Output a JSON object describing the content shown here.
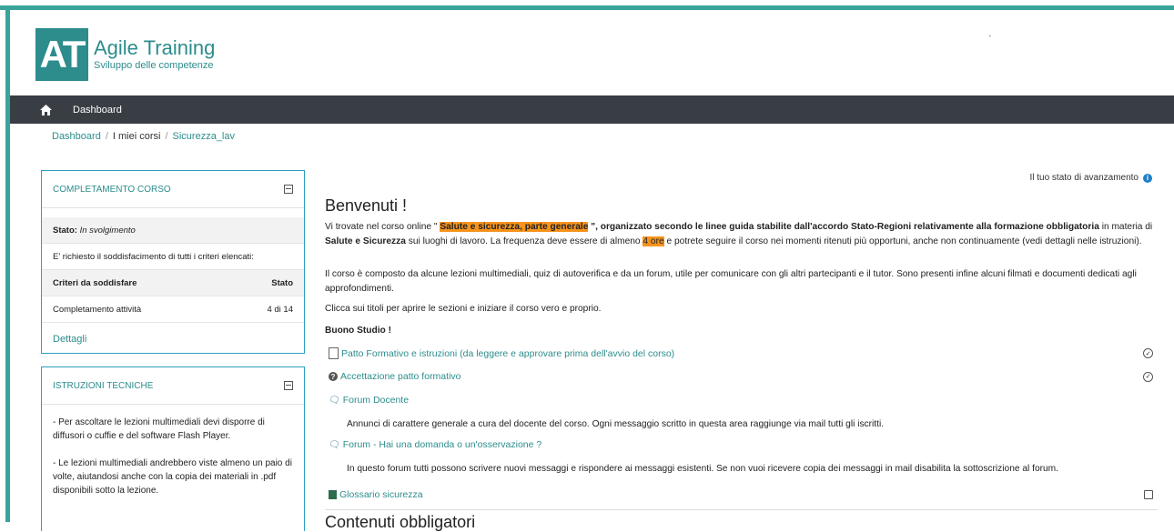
{
  "header": {
    "logo_mark": "AT",
    "logo_title": "Agile Training",
    "logo_subtitle": "Sviluppo delle competenze",
    "top_right_mark": "'"
  },
  "navbar": {
    "home_icon": "home-icon",
    "dashboard": "Dashboard"
  },
  "breadcrumb": {
    "items": [
      "Dashboard",
      "I miei corsi",
      "Sicurezza_lav"
    ],
    "separator": "/"
  },
  "completion_block": {
    "title": "COMPLETAMENTO CORSO",
    "status_label": "Stato:",
    "status_value": "In svolgimento",
    "requirement": "E' richiesto il soddisfacimento di tutti i criteri elencati:",
    "criteria_header": "Criteri da soddisfare",
    "status_header": "Stato",
    "criteria": [
      {
        "name": "Completamento attività",
        "status": "4 di 14"
      }
    ],
    "details_link": "Dettagli"
  },
  "instructions_block": {
    "title": "ISTRUZIONI TECNICHE",
    "paragraphs": [
      "- Per ascoltare le lezioni multimediali devi disporre di diffusori o cuffie e del software Flash Player.",
      "- Le lezioni multimediali andrebbero viste almeno un paio di volte, aiutandosi anche con la copia dei materiali in .pdf disponibili sotto la lezione."
    ]
  },
  "main": {
    "progress_label": "Il tuo stato di avanzamento",
    "welcome": "Benvenuti !",
    "intro": {
      "p1a": "Vi trovate nel corso online \" ",
      "p1_course": "Salute e sicurezza, parte generale",
      "p1b": " \", organizzato secondo le linee guida stabilite dall'accordo Stato-Regioni relativamente alla ",
      "p1_bold": "formazione obbligatoria",
      "p1c": " in materia di ",
      "p1_bold2": "Salute e Sicurezza",
      "p1d": " sui luoghi di lavoro. La frequenza deve essere di almeno ",
      "p1_hours": "4 ore",
      "p1e": "  e potrete seguire il corso  nei momenti ritenuti più opportuni, anche non continuamente (vedi dettagli nelle istruzioni).",
      "p2": "Il corso è composto da alcune lezioni multimediali, quiz di autoverifica e da un forum, utile per comunicare con gli altri partecipanti e il tutor. Sono presenti infine  alcuni filmati e documenti dedicati agli approfondimenti.",
      "p3": "Clicca sui titoli per aprire le sezioni e iniziare il corso vero e proprio.",
      "p4": "Buono Studio !"
    },
    "activities": [
      {
        "label": "Patto Formativo e istruzioni (da leggere e approvare prima dell'avvio del corso)",
        "icon": "document-icon",
        "completion": "auto-check"
      },
      {
        "label": "Accettazione patto formativo",
        "icon": "question-icon",
        "completion": "auto-check"
      },
      {
        "label": "Forum Docente",
        "icon": "forum-icon",
        "completion": "",
        "description": "Annunci di carattere generale a cura del docente del corso. Ogni messaggio scritto in questa area raggiunge via mail tutti gli iscritti."
      },
      {
        "label": "Forum - Hai una domanda o un'osservazione ?",
        "icon": "forum-icon",
        "completion": "",
        "description": "In questo forum tutti possono scrivere nuovi messaggi  e rispondere ai messaggi esistenti.  Se non vuoi ricevere copia dei messaggi in mail disabilita la sottoscrizione al forum."
      },
      {
        "label": "Glossario sicurezza",
        "icon": "glossary-icon",
        "completion": "manual-box"
      }
    ],
    "next_section": "Contenuti obbligatori"
  },
  "colors": {
    "teal": "#2d8c8c",
    "frame": "#3aa39a",
    "navbar": "#383e44",
    "highlight": "#f7941d",
    "block_border": "#2d9fc0"
  }
}
